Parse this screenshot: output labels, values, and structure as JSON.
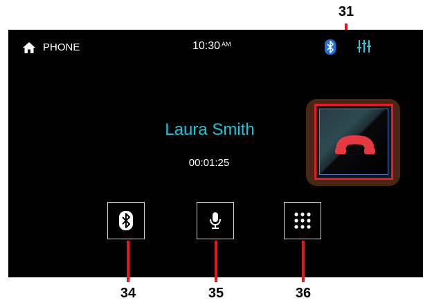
{
  "status_bar": {
    "home_icon": "home-icon",
    "section_label": "PHONE",
    "time": "10:30",
    "time_suffix": "AM",
    "bluetooth_icon": "bluetooth-icon",
    "equalizer_icon": "equalizer-icon"
  },
  "call": {
    "caller_name": "Laura Smith",
    "duration": "00:01:25",
    "hangup_icon": "hang-up-phone-icon"
  },
  "controls": [
    {
      "icon": "bluetooth-icon"
    },
    {
      "icon": "microphone-icon"
    },
    {
      "icon": "keypad-icon"
    }
  ],
  "callouts": {
    "hangup": "31",
    "bluetooth": "34",
    "microphone": "35",
    "keypad": "36"
  },
  "colors": {
    "screen_bg": "#000000",
    "caller_name": "#18c6dd",
    "bluetooth_badge": "#1e6fe0",
    "equalizer": "#2bc6e0",
    "hangup_border": "#e01e2a",
    "hangup_handset": "#e53a44",
    "callout_line": "#e0171e"
  }
}
